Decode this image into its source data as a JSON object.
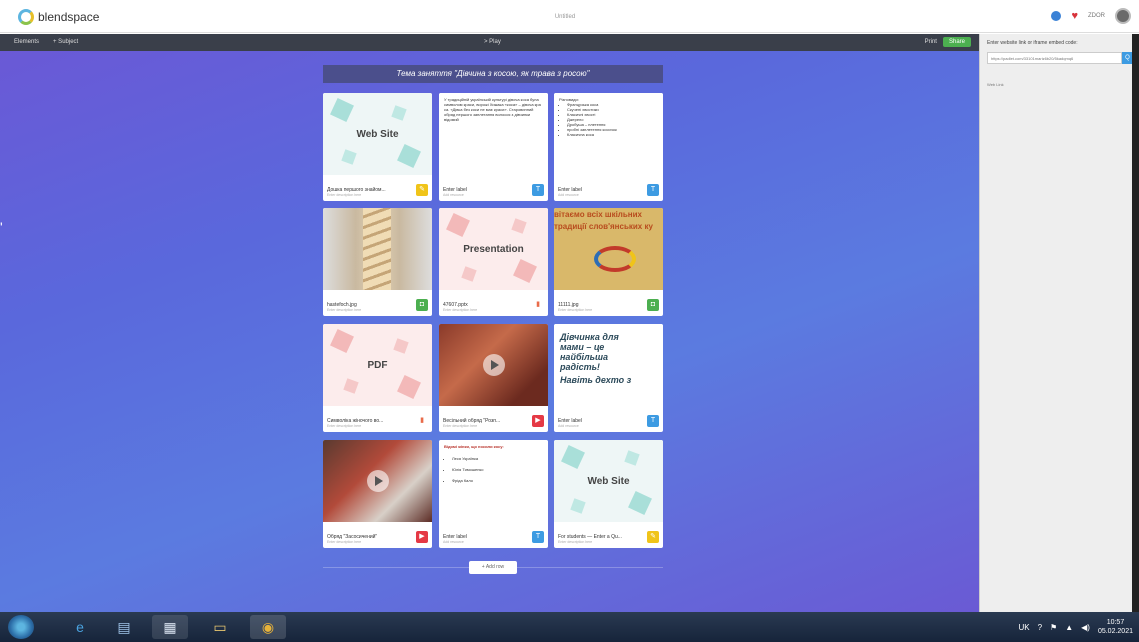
{
  "header": {
    "brand": "blendspace",
    "center_title": "Untitled",
    "user": "ZDOR"
  },
  "toolbar": {
    "elements": "Elements",
    "subject": "+ Subject",
    "play": "> Play",
    "print": "Print",
    "share": "Share"
  },
  "lesson": {
    "title": "Тема заняття \"Дівчина з косою, як трава з росою\""
  },
  "tiles": [
    {
      "thumb_title": "Web Site",
      "label": "Дошка першого знайом...",
      "sub": "Enter description here",
      "badge": "✎",
      "badge_color": "#f0c419"
    },
    {
      "text": "У традиційній українській культурі дівоча коса була символом краси, ворожі Хижака «коса» – дівоча кра са. «Дівка без коси не має краси». Старовинний обряд першого заплетання волосся з дівчинки відомий",
      "label": "Enter label",
      "sub": "Add resource",
      "badge": "T",
      "badge_color": "#3d9be2"
    },
    {
      "heading": "Різновиди:",
      "items": [
        "Французька коса",
        "Скучені хвостики",
        "Класичні хвості",
        "Джерело",
        "Дробуша – плетення",
        "пробні заплетення косичок",
        "Класична коса"
      ],
      "label": "Enter label",
      "sub": "Add resource",
      "badge": "T",
      "badge_color": "#3d9be2"
    },
    {
      "label": "hastefoch.jpg",
      "sub": "Enter description here",
      "badge": "◘",
      "badge_color": "#4caf50"
    },
    {
      "thumb_title": "Presentation",
      "label": "47607.pptx",
      "sub": "Enter description here",
      "badge": "▮",
      "badge_color": "#fff"
    },
    {
      "banner_lines": [
        "вітаємо всіх шкільних",
        "традиції слов'янських ку"
      ],
      "label": "11111.jpg",
      "sub": "Enter description here",
      "badge": "◘",
      "badge_color": "#4caf50"
    },
    {
      "thumb_title": "PDF",
      "label": "Символіка жіночого во...",
      "sub": "Enter description here",
      "badge": "▮",
      "badge_color": "#fff"
    },
    {
      "label": "Весільний обряд \"Розп...",
      "sub": "Enter description here",
      "badge": "▶",
      "badge_color": "#e53945"
    },
    {
      "italic_lines": [
        "Дівчинка для",
        "мами – це",
        "найбільша",
        "радість!",
        "Навіть дехто з"
      ],
      "label": "Enter label",
      "sub": "Add resource",
      "badge": "T",
      "badge_color": "#3d9be2"
    },
    {
      "label": "Обряд \"Засосичений\"",
      "sub": "Enter description here",
      "badge": "▶",
      "badge_color": "#e53945"
    },
    {
      "heading": "Відомі жінки, що носили косу:",
      "items": [
        "Леся Українка",
        "Юлія Тимошенко",
        "Фріда Кало"
      ],
      "label": "Enter label",
      "sub": "Add resource",
      "badge": "T",
      "badge_color": "#3d9be2"
    },
    {
      "thumb_title": "Web Site",
      "label": "For students — Enter a Qu...",
      "sub": "Enter description here",
      "badge": "✎",
      "badge_color": "#f0c419"
    }
  ],
  "add_row": "+ Add row",
  "right_panel": {
    "label": "Enter website link or iframe embed code:",
    "input_value": "https://padlet.com/33101mariz6b20/5kadqmq6",
    "go": "Q",
    "link": "Web Link"
  },
  "taskbar": {
    "lang": "UK",
    "time": "10:57",
    "date": "05.02.2021"
  }
}
